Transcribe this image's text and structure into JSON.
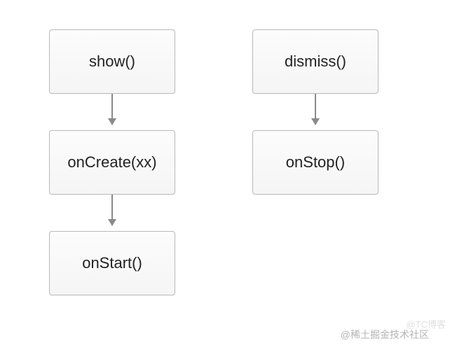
{
  "diagram": {
    "left": {
      "n1": "show()",
      "n2": "onCreate(xx)",
      "n3": "onStart()"
    },
    "right": {
      "n1": "dismiss()",
      "n2": "onStop()"
    }
  },
  "watermarks": {
    "main": "@稀土掘金技术社区",
    "faint": "@TC博客"
  }
}
